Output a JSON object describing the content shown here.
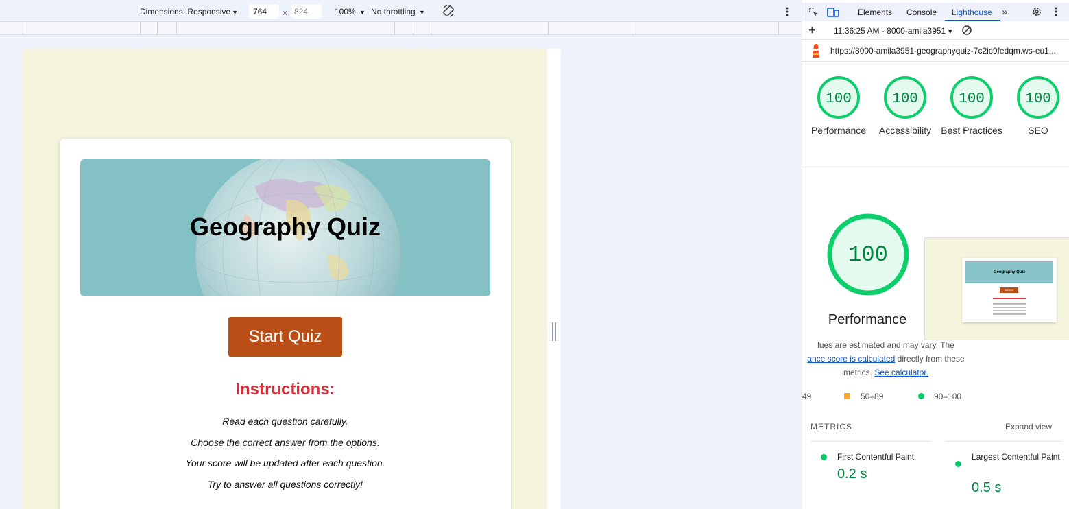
{
  "emulator": {
    "dimensions_label": "Dimensions: Responsive",
    "width_value": "764",
    "times": "×",
    "height_placeholder": "824",
    "zoom": "100%",
    "throttling": "No throttling"
  },
  "page": {
    "title": "Geography Quiz",
    "start_button": "Start Quiz",
    "instructions_heading": "Instructions:",
    "instructions": [
      "Read each question carefully.",
      "Choose the correct answer from the options.",
      "Your score will be updated after each question.",
      "Try to answer all questions correctly!"
    ]
  },
  "devtools": {
    "tabs": {
      "elements": "Elements",
      "console": "Console",
      "lighthouse": "Lighthouse",
      "more": "»"
    },
    "report_bar": {
      "add": "+",
      "report_select": "11:36:25 AM - 8000-amila3951"
    },
    "url": "https://8000-amila3951-geographyquiz-7c2ic9fedqm.ws-eu1...",
    "scores": [
      {
        "value": "100",
        "label": "Performance"
      },
      {
        "value": "100",
        "label": "Accessibility"
      },
      {
        "value": "100",
        "label": "Best Practices"
      },
      {
        "value": "100",
        "label": "SEO"
      }
    ],
    "big_score": {
      "value": "100",
      "label": "Performance"
    },
    "thumbnail": {
      "title": "Geography Quiz",
      "button": "Start Quiz"
    },
    "description": {
      "line1": "lues are estimated and may vary. The",
      "link1": "ance score is calculated",
      "line2_rest": " directly from these",
      "line3": "metrics. ",
      "link2": "See calculator."
    },
    "legend": {
      "fail": "49",
      "average": "50–89",
      "pass": "90–100"
    },
    "metrics": {
      "title": "METRICS",
      "expand": "Expand view",
      "items": [
        {
          "name": "First Contentful Paint",
          "value": "0.2 s"
        },
        {
          "name": "Largest Contentful Paint",
          "value": "0.5 s"
        }
      ]
    },
    "colors": {
      "pass": "#0cce6b",
      "pass_text": "#018642",
      "average": "#ffaa33",
      "accent": "#0b57d0"
    }
  }
}
